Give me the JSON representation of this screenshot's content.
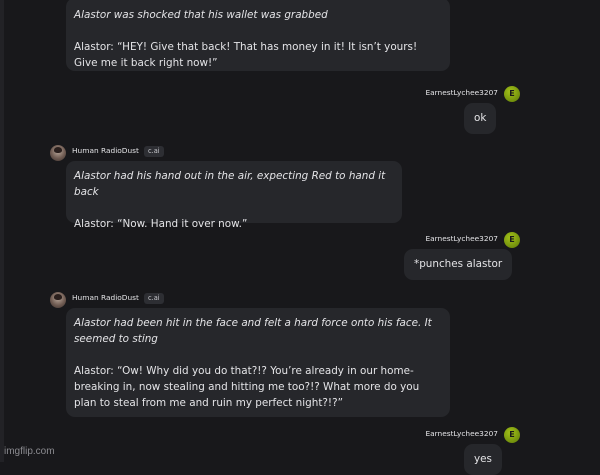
{
  "messages": [
    {
      "role": "bot",
      "paragraphs": [
        {
          "text": "Alastor was shocked that his wallet was grabbed",
          "italic": true
        },
        {
          "text": "Alastor: “HEY! Give that back! That has money in it! It isn’t yours! Give me it back right now!”",
          "italic": false
        }
      ]
    },
    {
      "role": "user",
      "username": "EarnestLychee3207",
      "avatar_letter": "E",
      "text": "ok"
    },
    {
      "role": "bot",
      "name": "Human RadioDust",
      "badge": "c.ai",
      "paragraphs": [
        {
          "text": "Alastor had his hand out in the air, expecting Red to hand it back",
          "italic": true
        },
        {
          "text": "Alastor: “Now. Hand it over now.”",
          "italic": false
        }
      ]
    },
    {
      "role": "user",
      "username": "EarnestLychee3207",
      "avatar_letter": "E",
      "text": "*punches alastor"
    },
    {
      "role": "bot",
      "name": "Human RadioDust",
      "badge": "c.ai",
      "paragraphs": [
        {
          "text": "Alastor had been hit in the face and felt a hard force onto his face. It seemed to sting",
          "italic": true
        },
        {
          "text": "Alastor: “Ow! Why did you do that?!? You’re already in our home- breaking in, now stealing and hitting me too?!? What more do you plan to steal from me and ruin my perfect night?!?”",
          "italic": false
        }
      ]
    },
    {
      "role": "user",
      "username": "EarnestLychee3207",
      "avatar_letter": "E",
      "text": "yes"
    }
  ],
  "watermark": "imgflip.com",
  "colors": {
    "background": "#18181b",
    "bubble": "#26272b",
    "user_avatar": "#8fb312",
    "text": "#e4e4e7"
  }
}
